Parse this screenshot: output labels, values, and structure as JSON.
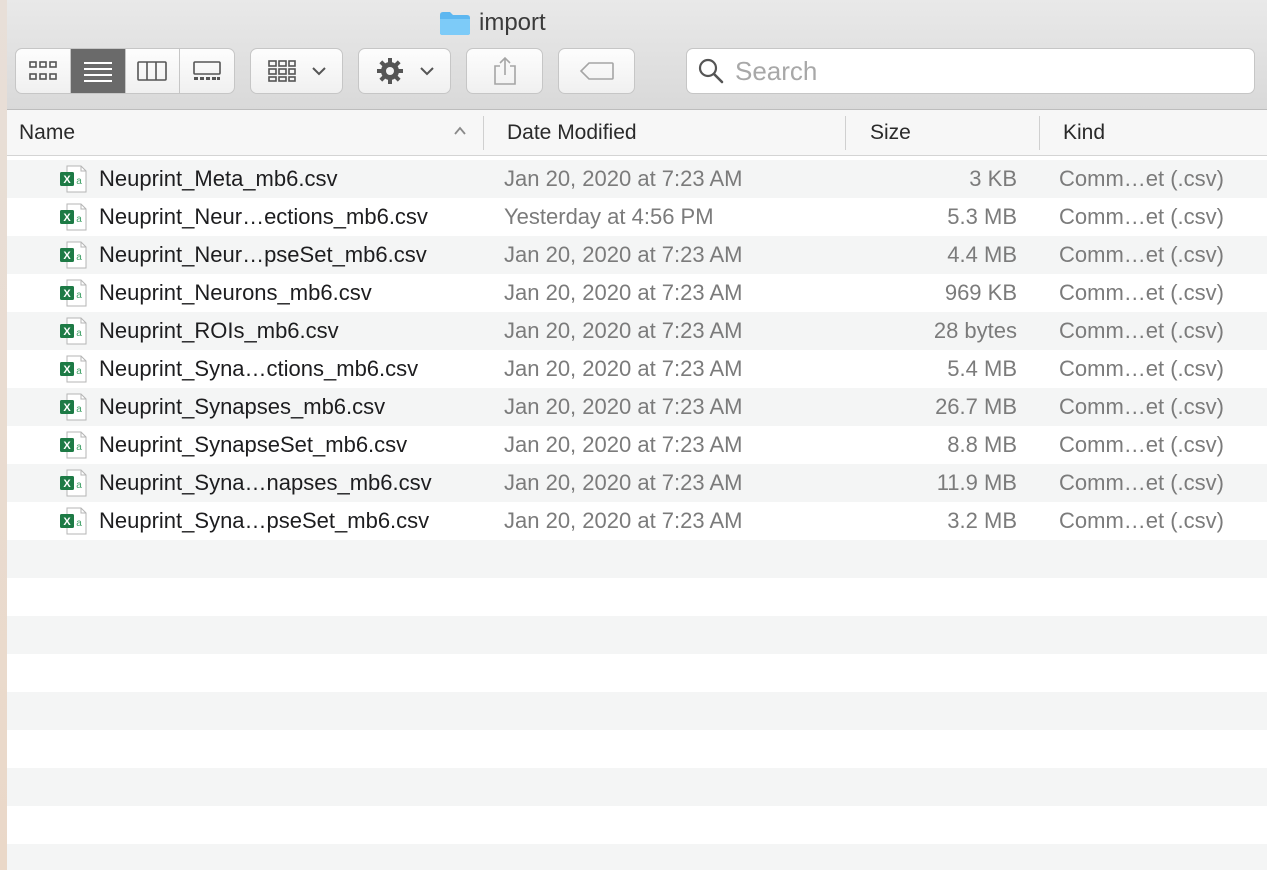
{
  "window": {
    "title": "import"
  },
  "toolbar": {
    "view_buttons": [
      "icon-view",
      "list-view",
      "column-view",
      "gallery-view"
    ],
    "active_view": "list-view",
    "search": {
      "placeholder": "Search",
      "value": ""
    }
  },
  "columns": {
    "name": "Name",
    "date": "Date Modified",
    "size": "Size",
    "kind": "Kind"
  },
  "colors": {
    "excel_green": "#1d7a45",
    "folder_blue": "#5db7f0",
    "active_segment": "#6a6a6a"
  },
  "files": [
    {
      "name": "Neuprint_Meta_mb6.csv",
      "date": "Jan 20, 2020 at 7:23 AM",
      "size": "3 KB",
      "kind": "Comm…et (.csv)"
    },
    {
      "name": "Neuprint_Neur…ections_mb6.csv",
      "date": "Yesterday at 4:56 PM",
      "size": "5.3 MB",
      "kind": "Comm…et (.csv)"
    },
    {
      "name": "Neuprint_Neur…pseSet_mb6.csv",
      "date": "Jan 20, 2020 at 7:23 AM",
      "size": "4.4 MB",
      "kind": "Comm…et (.csv)"
    },
    {
      "name": "Neuprint_Neurons_mb6.csv",
      "date": "Jan 20, 2020 at 7:23 AM",
      "size": "969 KB",
      "kind": "Comm…et (.csv)"
    },
    {
      "name": "Neuprint_ROIs_mb6.csv",
      "date": "Jan 20, 2020 at 7:23 AM",
      "size": "28 bytes",
      "kind": "Comm…et (.csv)"
    },
    {
      "name": "Neuprint_Syna…ctions_mb6.csv",
      "date": "Jan 20, 2020 at 7:23 AM",
      "size": "5.4 MB",
      "kind": "Comm…et (.csv)"
    },
    {
      "name": "Neuprint_Synapses_mb6.csv",
      "date": "Jan 20, 2020 at 7:23 AM",
      "size": "26.7 MB",
      "kind": "Comm…et (.csv)"
    },
    {
      "name": "Neuprint_SynapseSet_mb6.csv",
      "date": "Jan 20, 2020 at 7:23 AM",
      "size": "8.8 MB",
      "kind": "Comm…et (.csv)"
    },
    {
      "name": "Neuprint_Syna…napses_mb6.csv",
      "date": "Jan 20, 2020 at 7:23 AM",
      "size": "11.9 MB",
      "kind": "Comm…et (.csv)"
    },
    {
      "name": "Neuprint_Syna…pseSet_mb6.csv",
      "date": "Jan 20, 2020 at 7:23 AM",
      "size": "3.2 MB",
      "kind": "Comm…et (.csv)"
    }
  ]
}
